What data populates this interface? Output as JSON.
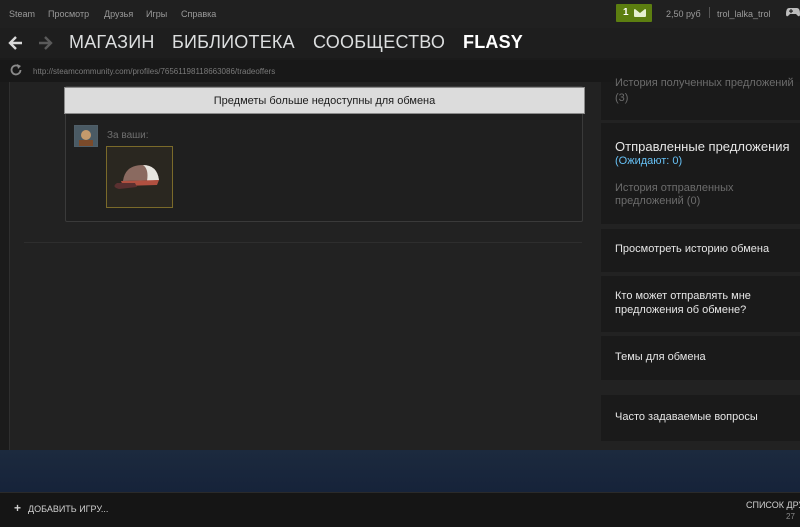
{
  "menu": {
    "items": [
      "Steam",
      "Просмотр",
      "Друзья",
      "Игры",
      "Справка"
    ]
  },
  "account": {
    "notification_count": "1",
    "wallet": "2,50 руб",
    "username": "trol_lalka_trol"
  },
  "nav": {
    "links": [
      "МАГАЗИН",
      "БИБЛИОТЕКА",
      "СООБЩЕСТВО",
      "FLASY"
    ],
    "active_index": 3,
    "url": "http://steamcommunity.com/profiles/76561198118663086/tradeoffers"
  },
  "trade": {
    "banner": "Предметы больше недоступны для обмена",
    "for_yours_label": "За ваши:",
    "item_icon": "cap-icon"
  },
  "sidebar": {
    "received_history": "История полученных предложений",
    "received_count": "(3)",
    "sent_title": "Отправленные предложения",
    "sent_pending": "(Ожидают: 0)",
    "sent_history_line1": "История отправленных",
    "sent_history_line2": "предложений (0)",
    "trade_history": "Просмотреть историю обмена",
    "who_can_line1": "Кто может отправлять мне",
    "who_can_line2": "предложения об обмене?",
    "trade_topics": "Темы для обмена",
    "faq": "Часто задаваемые вопросы"
  },
  "bottom": {
    "add_game": "ДОБАВИТЬ ИГРУ...",
    "friends_list": "СПИСОК ДРУЗЕЙ",
    "friends_online": "27"
  },
  "colors": {
    "accent_green": "#5c7e10",
    "link_blue": "#66c0f4",
    "item_border": "#7a6a2a"
  }
}
